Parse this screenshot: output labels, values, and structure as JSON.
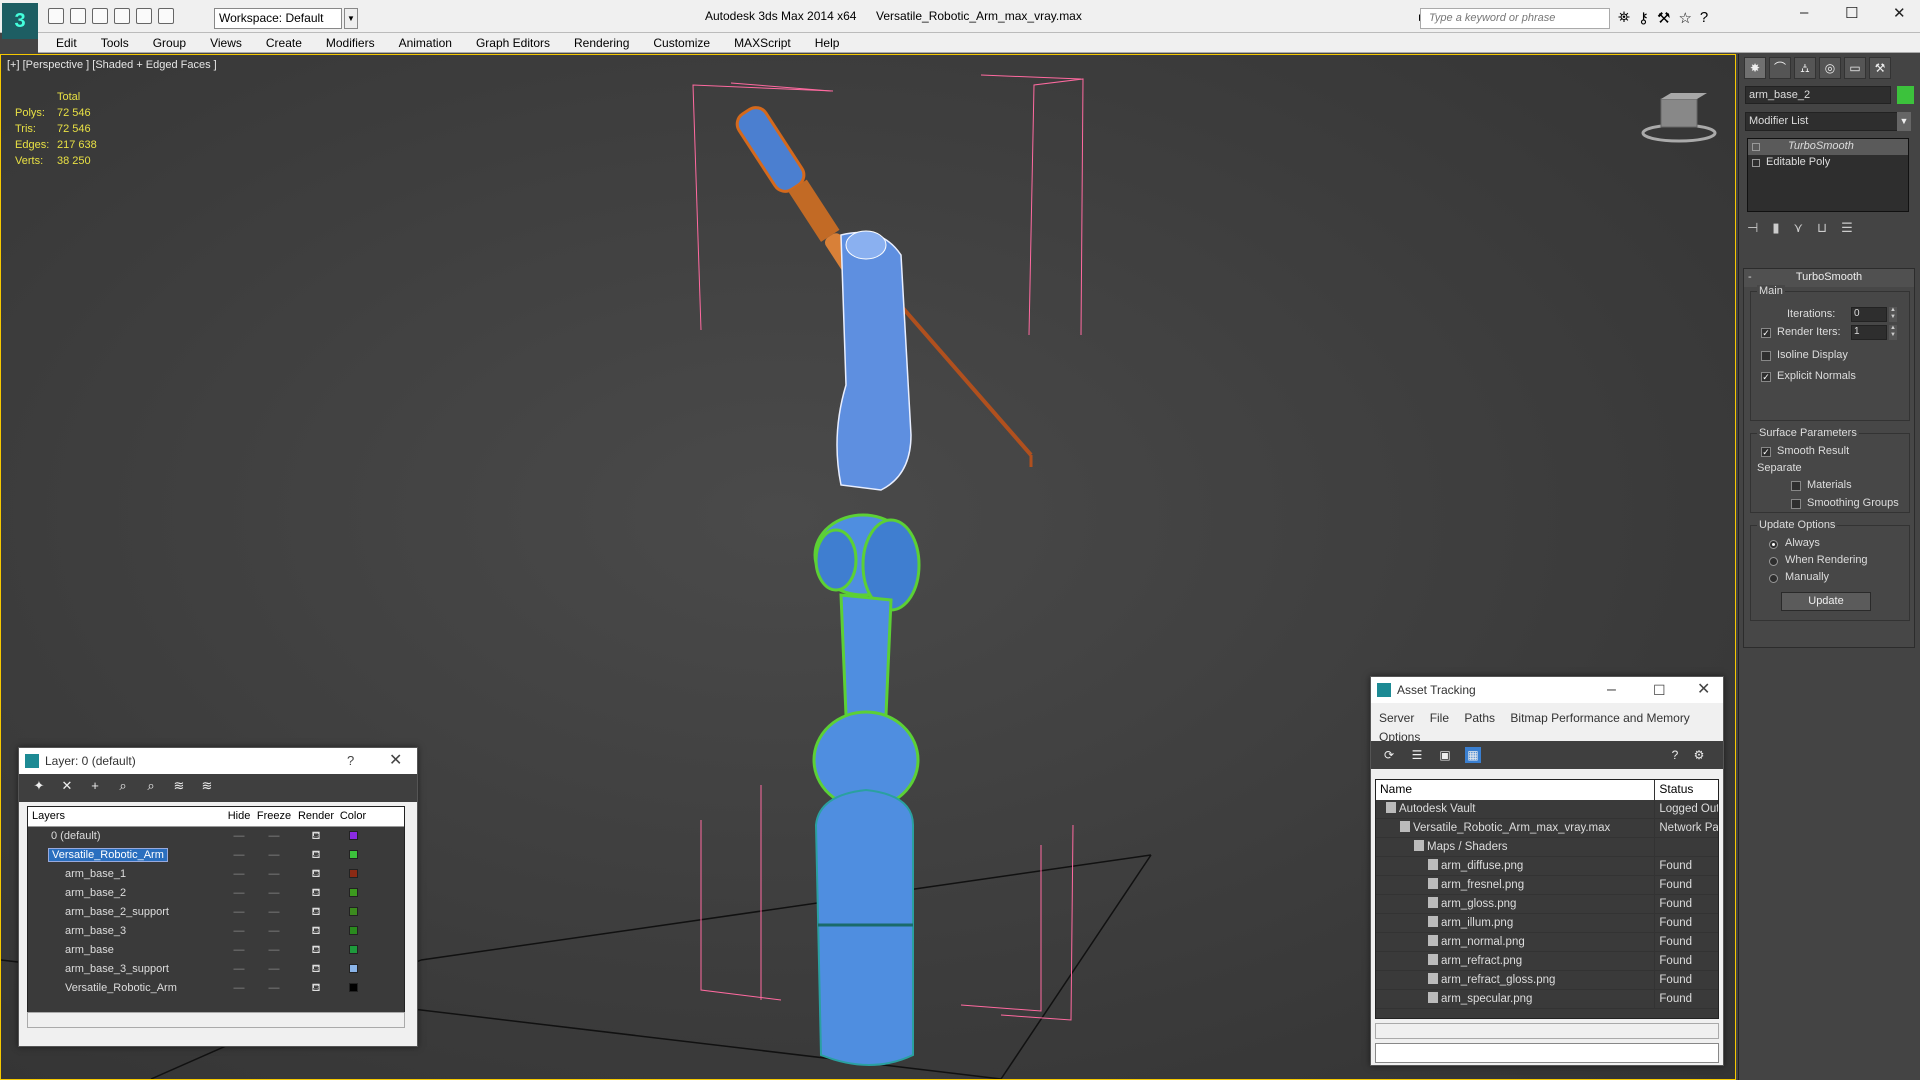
{
  "window": {
    "app_title": "Autodesk 3ds Max  2014 x64",
    "file_title": "Versatile_Robotic_Arm_max_vray.max",
    "workspace": "Workspace: Default",
    "search_placeholder": "Type a keyword or phrase"
  },
  "menu": [
    "Edit",
    "Tools",
    "Group",
    "Views",
    "Create",
    "Modifiers",
    "Animation",
    "Graph Editors",
    "Rendering",
    "Customize",
    "MAXScript",
    "Help"
  ],
  "viewport": {
    "label": "[+] [Perspective ] [Shaded + Edged Faces ]",
    "stats_header": "Total",
    "stats": [
      {
        "k": "Polys:",
        "v": "72 546"
      },
      {
        "k": "Tris:",
        "v": "72 546"
      },
      {
        "k": "Edges:",
        "v": "217 638"
      },
      {
        "k": "Verts:",
        "v": "38 250"
      }
    ]
  },
  "command_panel": {
    "object_name": "arm_base_2",
    "object_color": "#3cc23c",
    "modifier_list": "Modifier List",
    "stack": [
      "TurboSmooth",
      "Editable Poly"
    ],
    "rollout_title": "TurboSmooth",
    "main_label": "Main",
    "iterations_label": "Iterations:",
    "iterations_value": "0",
    "render_iters_label": "Render Iters:",
    "render_iters_value": "1",
    "isoline": "Isoline Display",
    "explicit_normals": "Explicit Normals",
    "surface_params": "Surface Parameters",
    "smooth_result": "Smooth Result",
    "separate": "Separate",
    "materials": "Materials",
    "smoothing_groups": "Smoothing Groups",
    "update_options": "Update Options",
    "always": "Always",
    "when_rendering": "When Rendering",
    "manually": "Manually",
    "update_btn": "Update"
  },
  "layer_dialog": {
    "title": "Layer: 0 (default)",
    "headers": {
      "layers": "Layers",
      "hide": "Hide",
      "freeze": "Freeze",
      "render": "Render",
      "color": "Color"
    },
    "rows": [
      {
        "name": "0 (default)",
        "color": "#8a2be2",
        "indent": 1
      },
      {
        "name": "Versatile_Robotic_Arm",
        "color": "#3cc23c",
        "indent": 1,
        "selected": true
      },
      {
        "name": "arm_base_1",
        "color": "#8b2a14",
        "indent": 2
      },
      {
        "name": "arm_base_2",
        "color": "#3c9a1e",
        "indent": 2
      },
      {
        "name": "arm_base_2_support",
        "color": "#3c8a1e",
        "indent": 2
      },
      {
        "name": "arm_base_3",
        "color": "#2a8a1e",
        "indent": 2
      },
      {
        "name": "arm_base",
        "color": "#1e9a3c",
        "indent": 2
      },
      {
        "name": "arm_base_3_support",
        "color": "#8ab4e8",
        "indent": 2
      },
      {
        "name": "Versatile_Robotic_Arm",
        "color": "#000000",
        "indent": 2
      }
    ]
  },
  "asset_dialog": {
    "title": "Asset Tracking",
    "menu": [
      "Server",
      "File",
      "Paths",
      "Bitmap Performance and Memory",
      "Options"
    ],
    "headers": {
      "name": "Name",
      "status": "Status"
    },
    "rows": [
      {
        "name": "Autodesk Vault",
        "status": "Logged Out",
        "indent": 1
      },
      {
        "name": "Versatile_Robotic_Arm_max_vray.max",
        "status": "Network Pa",
        "indent": 2
      },
      {
        "name": "Maps / Shaders",
        "status": "",
        "indent": 3
      },
      {
        "name": "arm_diffuse.png",
        "status": "Found",
        "indent": 4
      },
      {
        "name": "arm_fresnel.png",
        "status": "Found",
        "indent": 4
      },
      {
        "name": "arm_gloss.png",
        "status": "Found",
        "indent": 4
      },
      {
        "name": "arm_illum.png",
        "status": "Found",
        "indent": 4
      },
      {
        "name": "arm_normal.png",
        "status": "Found",
        "indent": 4
      },
      {
        "name": "arm_refract.png",
        "status": "Found",
        "indent": 4
      },
      {
        "name": "arm_refract_gloss.png",
        "status": "Found",
        "indent": 4
      },
      {
        "name": "arm_specular.png",
        "status": "Found",
        "indent": 4
      }
    ]
  }
}
